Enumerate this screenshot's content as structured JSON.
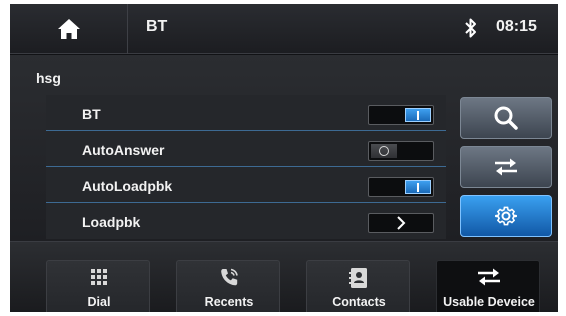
{
  "header": {
    "title": "BT",
    "time": "08:15",
    "home_icon": "home-icon",
    "status_icon": "bluetooth-icon"
  },
  "device": {
    "name": "hsg"
  },
  "settings": [
    {
      "label": "BT",
      "control": "toggle",
      "state": "on"
    },
    {
      "label": "AutoAnswer",
      "control": "toggle",
      "state": "off"
    },
    {
      "label": "AutoLoadpbk",
      "control": "toggle",
      "state": "on"
    },
    {
      "label": "Loadpbk",
      "control": "chevron",
      "icon": "chevron-right-icon"
    }
  ],
  "side_buttons": [
    {
      "icon": "search-icon",
      "active": false
    },
    {
      "icon": "swap-arrows-icon",
      "active": false
    },
    {
      "icon": "gear-icon",
      "active": true
    }
  ],
  "tabs": [
    {
      "label": "Dial",
      "icon": "keypad-icon",
      "active": false
    },
    {
      "label": "Recents",
      "icon": "phone-call-icon",
      "active": false
    },
    {
      "label": "Contacts",
      "icon": "contact-card-icon",
      "active": false
    },
    {
      "label": "Usable Deveice",
      "icon": "swap-arrows-icon",
      "active": true
    }
  ],
  "colors": {
    "accent": "#2a8fe6",
    "background": "#1e1f23",
    "divider": "#3d6a93"
  }
}
